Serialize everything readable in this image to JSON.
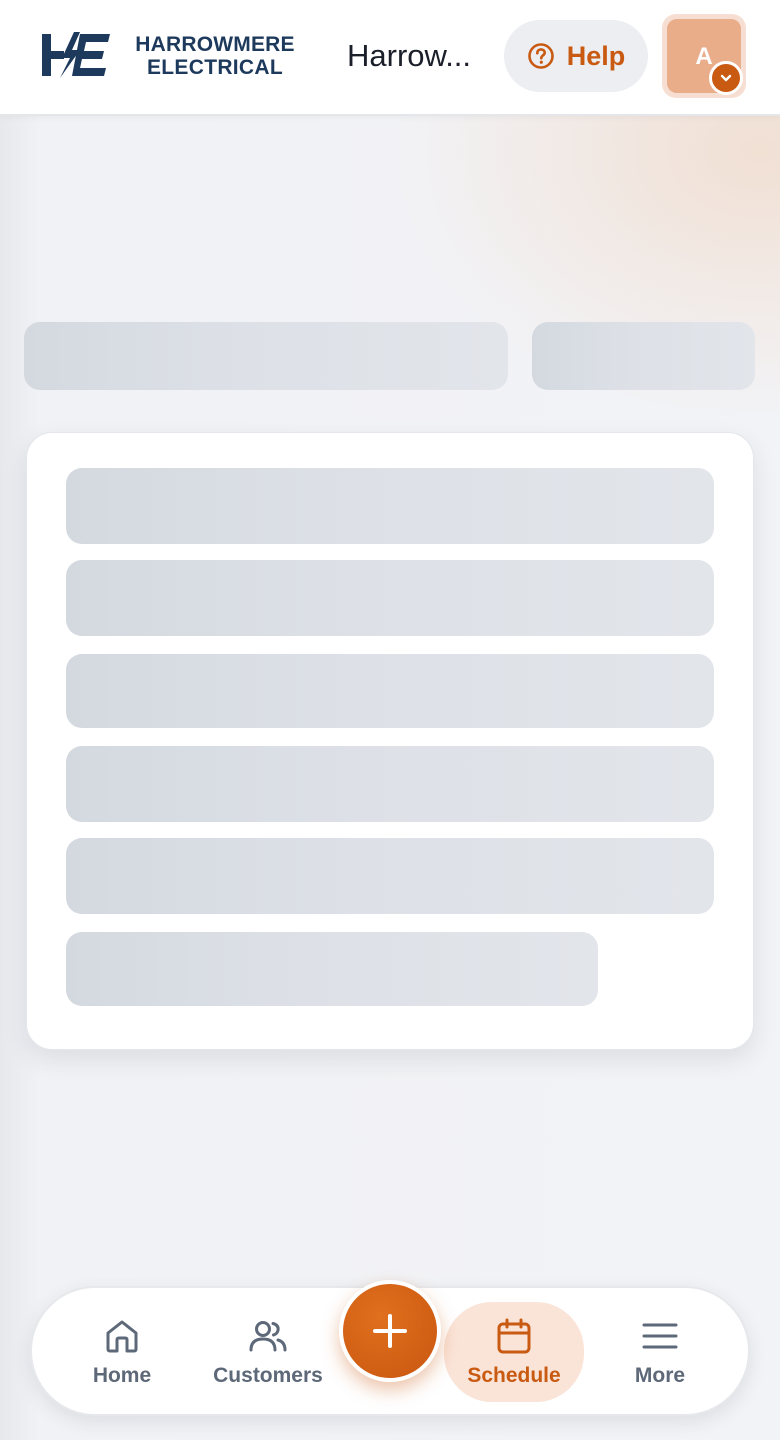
{
  "header": {
    "logo_line1": "HARROWMERE",
    "logo_line2": "ELECTRICAL",
    "company_name": "Harrow...",
    "help_label": "Help",
    "help_icon": "question-circle-icon",
    "avatar_initial": "A",
    "avatar_badge_icon": "chevron-down-icon"
  },
  "nav": {
    "items": [
      {
        "label": "Home",
        "icon": "home-icon"
      },
      {
        "label": "Customers",
        "icon": "users-icon"
      },
      {
        "label": "Schedule",
        "icon": "calendar-icon",
        "active": true
      },
      {
        "label": "More",
        "icon": "menu-icon"
      }
    ],
    "fab_icon": "plus-icon"
  },
  "colors": {
    "accent": "#c95a12",
    "brand_navy": "#1d3a5c",
    "skeleton": "#d9dde3"
  }
}
